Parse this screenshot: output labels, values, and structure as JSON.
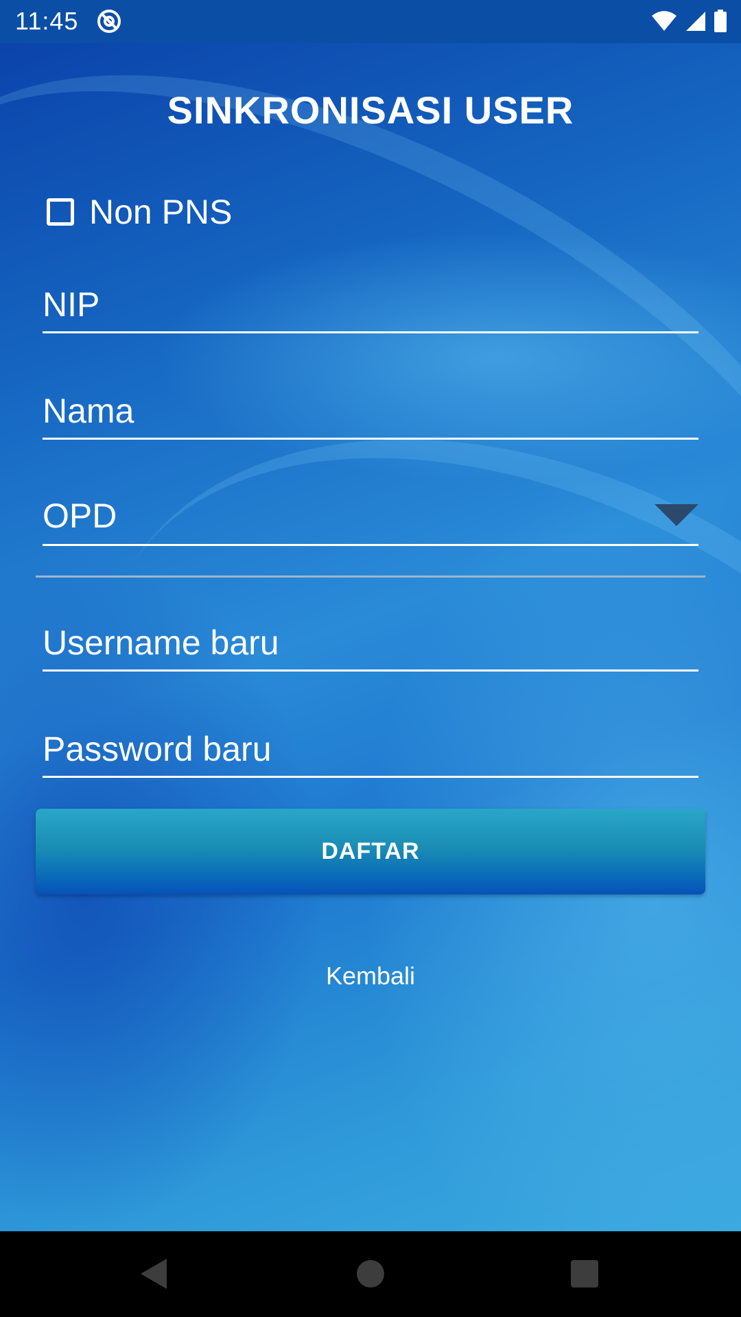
{
  "status_bar": {
    "time": "11:45"
  },
  "colors": {
    "background_primary": "#1565c0",
    "background_light": "#3aa8df",
    "button_gradient_top": "#2aa6c8",
    "button_gradient_bottom": "#0652b8",
    "text": "#ffffff",
    "spinner_arrow": "#2b4a6b"
  },
  "page": {
    "title": "SINKRONISASI USER"
  },
  "form": {
    "non_pns_checkbox": {
      "label": "Non PNS",
      "checked": false
    },
    "nip": {
      "placeholder": "NIP",
      "value": ""
    },
    "nama": {
      "placeholder": "Nama",
      "value": ""
    },
    "opd": {
      "selected": "OPD"
    },
    "username": {
      "placeholder": "Username baru",
      "value": ""
    },
    "password": {
      "placeholder": "Password baru",
      "value": ""
    },
    "submit_label": "DAFTAR",
    "back_link": "Kembali"
  },
  "icons": {
    "status_left": "at-sign-icon",
    "status_right": [
      "wifi-icon",
      "cell-signal-icon",
      "battery-icon"
    ],
    "spinner": "dropdown-triangle-icon",
    "nav": [
      "back-icon",
      "home-icon",
      "recents-icon"
    ]
  }
}
